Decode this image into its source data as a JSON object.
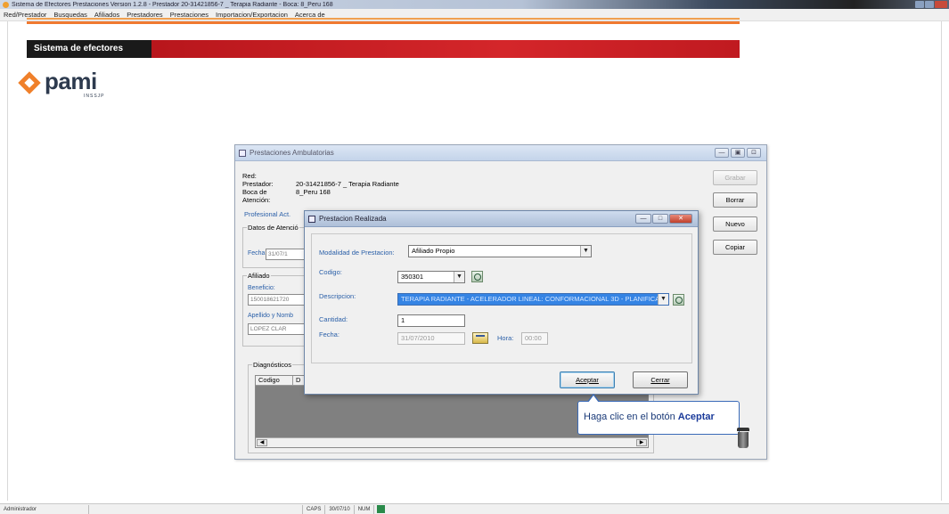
{
  "window": {
    "title": "Sistema de Efectores Prestaciones Version 1.2.8 - Prestador 20-31421856-7 _ Terapia Radiante - Boca: 8_Peru 168"
  },
  "menu": [
    "Red/Prestador",
    "Busquedas",
    "Afiliados",
    "Prestadores",
    "Prestaciones",
    "Importacion/Exportacion",
    "Acerca de"
  ],
  "header": {
    "system_title": "Sistema de efectores"
  },
  "logo": {
    "word": "pami",
    "sub": "INSSJP"
  },
  "colors": {
    "accent_red": "#c01a20",
    "accent_orange": "#f0802a",
    "selection_blue": "#3584e4",
    "link_blue": "#2a5fa8"
  },
  "bg_dialog": {
    "title": "Prestaciones Ambulatorias",
    "title_buttons": [
      "—",
      "▣",
      "⊡"
    ],
    "red_label": "Red:",
    "prestador_label": "Prestador:",
    "prestador_value": "20-31421856-7 _ Terapia Radiante",
    "boca_label": "Boca de Atención:",
    "boca_value": "8_Peru 168",
    "profesional_label": "Profesional Act.",
    "datos_atencion": "Datos de Atenció",
    "fecha_label": "Fecha:",
    "fecha_value": "31/07/1",
    "afiliado_group": "Afiliado",
    "beneficio_label": "Beneficio:",
    "beneficio_value": "150018621720",
    "apellido_label": "Apellido y Nomb",
    "apellido_value": "LOPEZ CLAR",
    "diagnosticos": "Diagnósticos",
    "diag_columns": [
      "Codigo",
      "D"
    ],
    "buttons": {
      "grabar": "Grabar",
      "borrar": "Borrar",
      "nuevo": "Nuevo",
      "copiar": "Copiar"
    }
  },
  "fg_dialog": {
    "title": "Prestacion Realizada",
    "modalidad_label": "Modalidad de Prestacion:",
    "modalidad_value": "Afiliado Propio",
    "codigo_label": "Codigo:",
    "codigo_value": "350301",
    "descripcion_label": "Descripcion:",
    "descripcion_value": "TERAPIA RADIANTE - ACELERADOR LINEAL: CONFORMACIONAL 3D - PLANIFICACION - MODULO",
    "cantidad_label": "Cantidad:",
    "cantidad_value": "1",
    "fecha_label": "Fecha:",
    "fecha_value": "31/07/2010",
    "hora_label": "Hora:",
    "hora_value": "00:00",
    "aceptar": "Aceptar",
    "cerrar": "Cerrar"
  },
  "tooltip": {
    "text": "Haga clic en el botón ",
    "bold": "Aceptar"
  },
  "statusbar": {
    "user": "Administrador",
    "caps": "CAPS",
    "date": "30/07/10",
    "num": "NUM"
  }
}
